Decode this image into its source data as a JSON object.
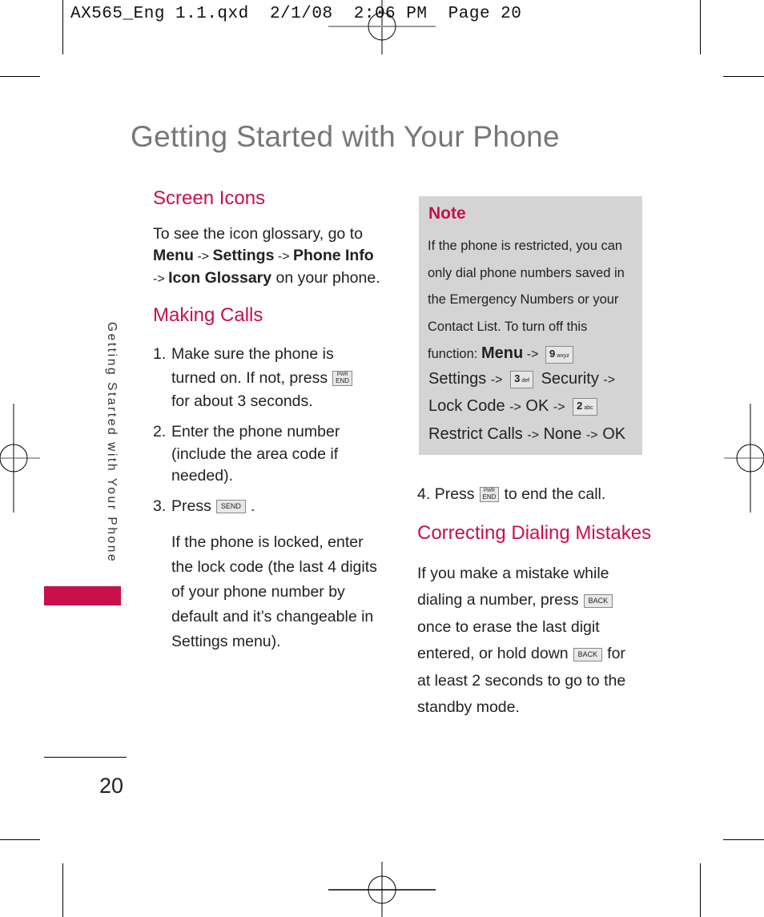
{
  "print_slug": "AX565_Eng 1.1.qxd  2/1/08  2:06 PM  Page 20",
  "page_title": "Getting Started with Your Phone",
  "side_label": "Getting Started with Your Phone",
  "page_number": "20",
  "colors": {
    "accent": "#c8104a",
    "title_gray": "#777777",
    "note_bg": "#d4d4d4"
  },
  "screen_icons": {
    "heading": "Screen Icons",
    "intro": "To see the icon glossary, go to",
    "path": [
      {
        "text": "Menu",
        "bold": true
      },
      {
        "text": " -> ",
        "bold": false
      },
      {
        "text": "Settings",
        "bold": true
      },
      {
        "text": " -> ",
        "bold": false
      },
      {
        "text": "Phone Info",
        "bold": true
      }
    ],
    "path2_arrow": "-> ",
    "path2_bold": "Icon Glossary",
    "path2_tail": " on your phone."
  },
  "making_calls": {
    "heading": "Making Calls",
    "steps": [
      {
        "num": "1.",
        "line1": "Make sure the phone is",
        "line2": "turned on. If not, press",
        "line3": "for about 3 seconds.",
        "key": "END",
        "key_sub": "PWR"
      },
      {
        "num": "2.",
        "text": "Enter the phone number (include the area code if needed)."
      },
      {
        "num": "3.",
        "text": "Press",
        "key": "SEND",
        "tail": "."
      },
      {
        "num": "4.",
        "text": "Press",
        "key": "END",
        "key_sub": "PWR",
        "tail": "to end the call."
      }
    ],
    "locked_note": "If the phone is locked, enter the lock code (the last 4 digits of your phone number by default and it’s changeable in Settings menu)."
  },
  "note": {
    "title": "Note",
    "text": "If the phone is restricted, you can only dial phone numbers saved in the Emergency Numbers or your Contact List. To turn off this",
    "function_label": "function:",
    "menu": "Menu",
    "arrow": "->",
    "key9": {
      "digit": "9",
      "letters": "wxyz"
    },
    "settings": "Settings",
    "key3": {
      "digit": "3",
      "letters": "def"
    },
    "security": "Security",
    "lock_code": "Lock Code",
    "ok": "OK",
    "key2": {
      "digit": "2",
      "letters": "abc"
    },
    "restrict_calls": "Restrict Calls",
    "none": "None"
  },
  "correcting": {
    "heading": "Correcting Dialing Mistakes",
    "line1": "If you make a mistake while",
    "line2": "dialing a number, press",
    "line3": "once to erase the last digit",
    "line4": "entered, or hold down",
    "line4_tail": "for",
    "line5": "at least 2 seconds to go to the",
    "line6": "standby mode.",
    "back_key": "BACK"
  }
}
